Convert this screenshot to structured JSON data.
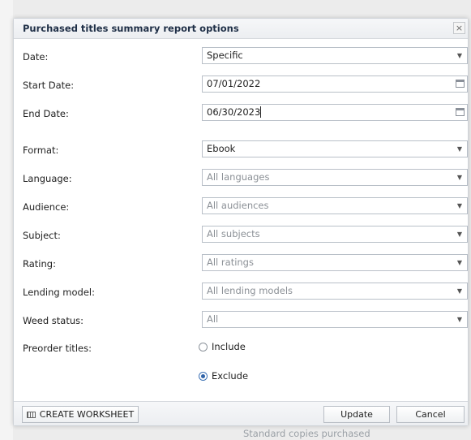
{
  "dialog": {
    "title": "Purchased titles summary report options",
    "close_glyph": "×"
  },
  "fields": {
    "date": {
      "label": "Date:",
      "value": "Specific"
    },
    "start_date": {
      "label": "Start Date:",
      "value": "07/01/2022"
    },
    "end_date": {
      "label": "End Date:",
      "value": "06/30/2023"
    },
    "format": {
      "label": "Format:",
      "value": "Ebook"
    },
    "language": {
      "label": "Language:",
      "value": "All languages"
    },
    "audience": {
      "label": "Audience:",
      "value": "All audiences"
    },
    "subject": {
      "label": "Subject:",
      "value": "All subjects"
    },
    "rating": {
      "label": "Rating:",
      "value": "All ratings"
    },
    "lending_model": {
      "label": "Lending model:",
      "value": "All lending models"
    },
    "weed_status": {
      "label": "Weed status:",
      "value": "All"
    },
    "preorder": {
      "label": "Preorder titles:",
      "options": [
        "Include",
        "Exclude"
      ],
      "selected": "Exclude"
    }
  },
  "footer": {
    "worksheet_label": "CREATE WORKSHEET",
    "update_label": "Update",
    "cancel_label": "Cancel"
  },
  "background": {
    "bottom_text": "Standard copies purchased"
  },
  "icons": {
    "dropdown": "chevron-down-icon",
    "calendar": "calendar-icon",
    "worksheet": "worksheet-icon"
  }
}
